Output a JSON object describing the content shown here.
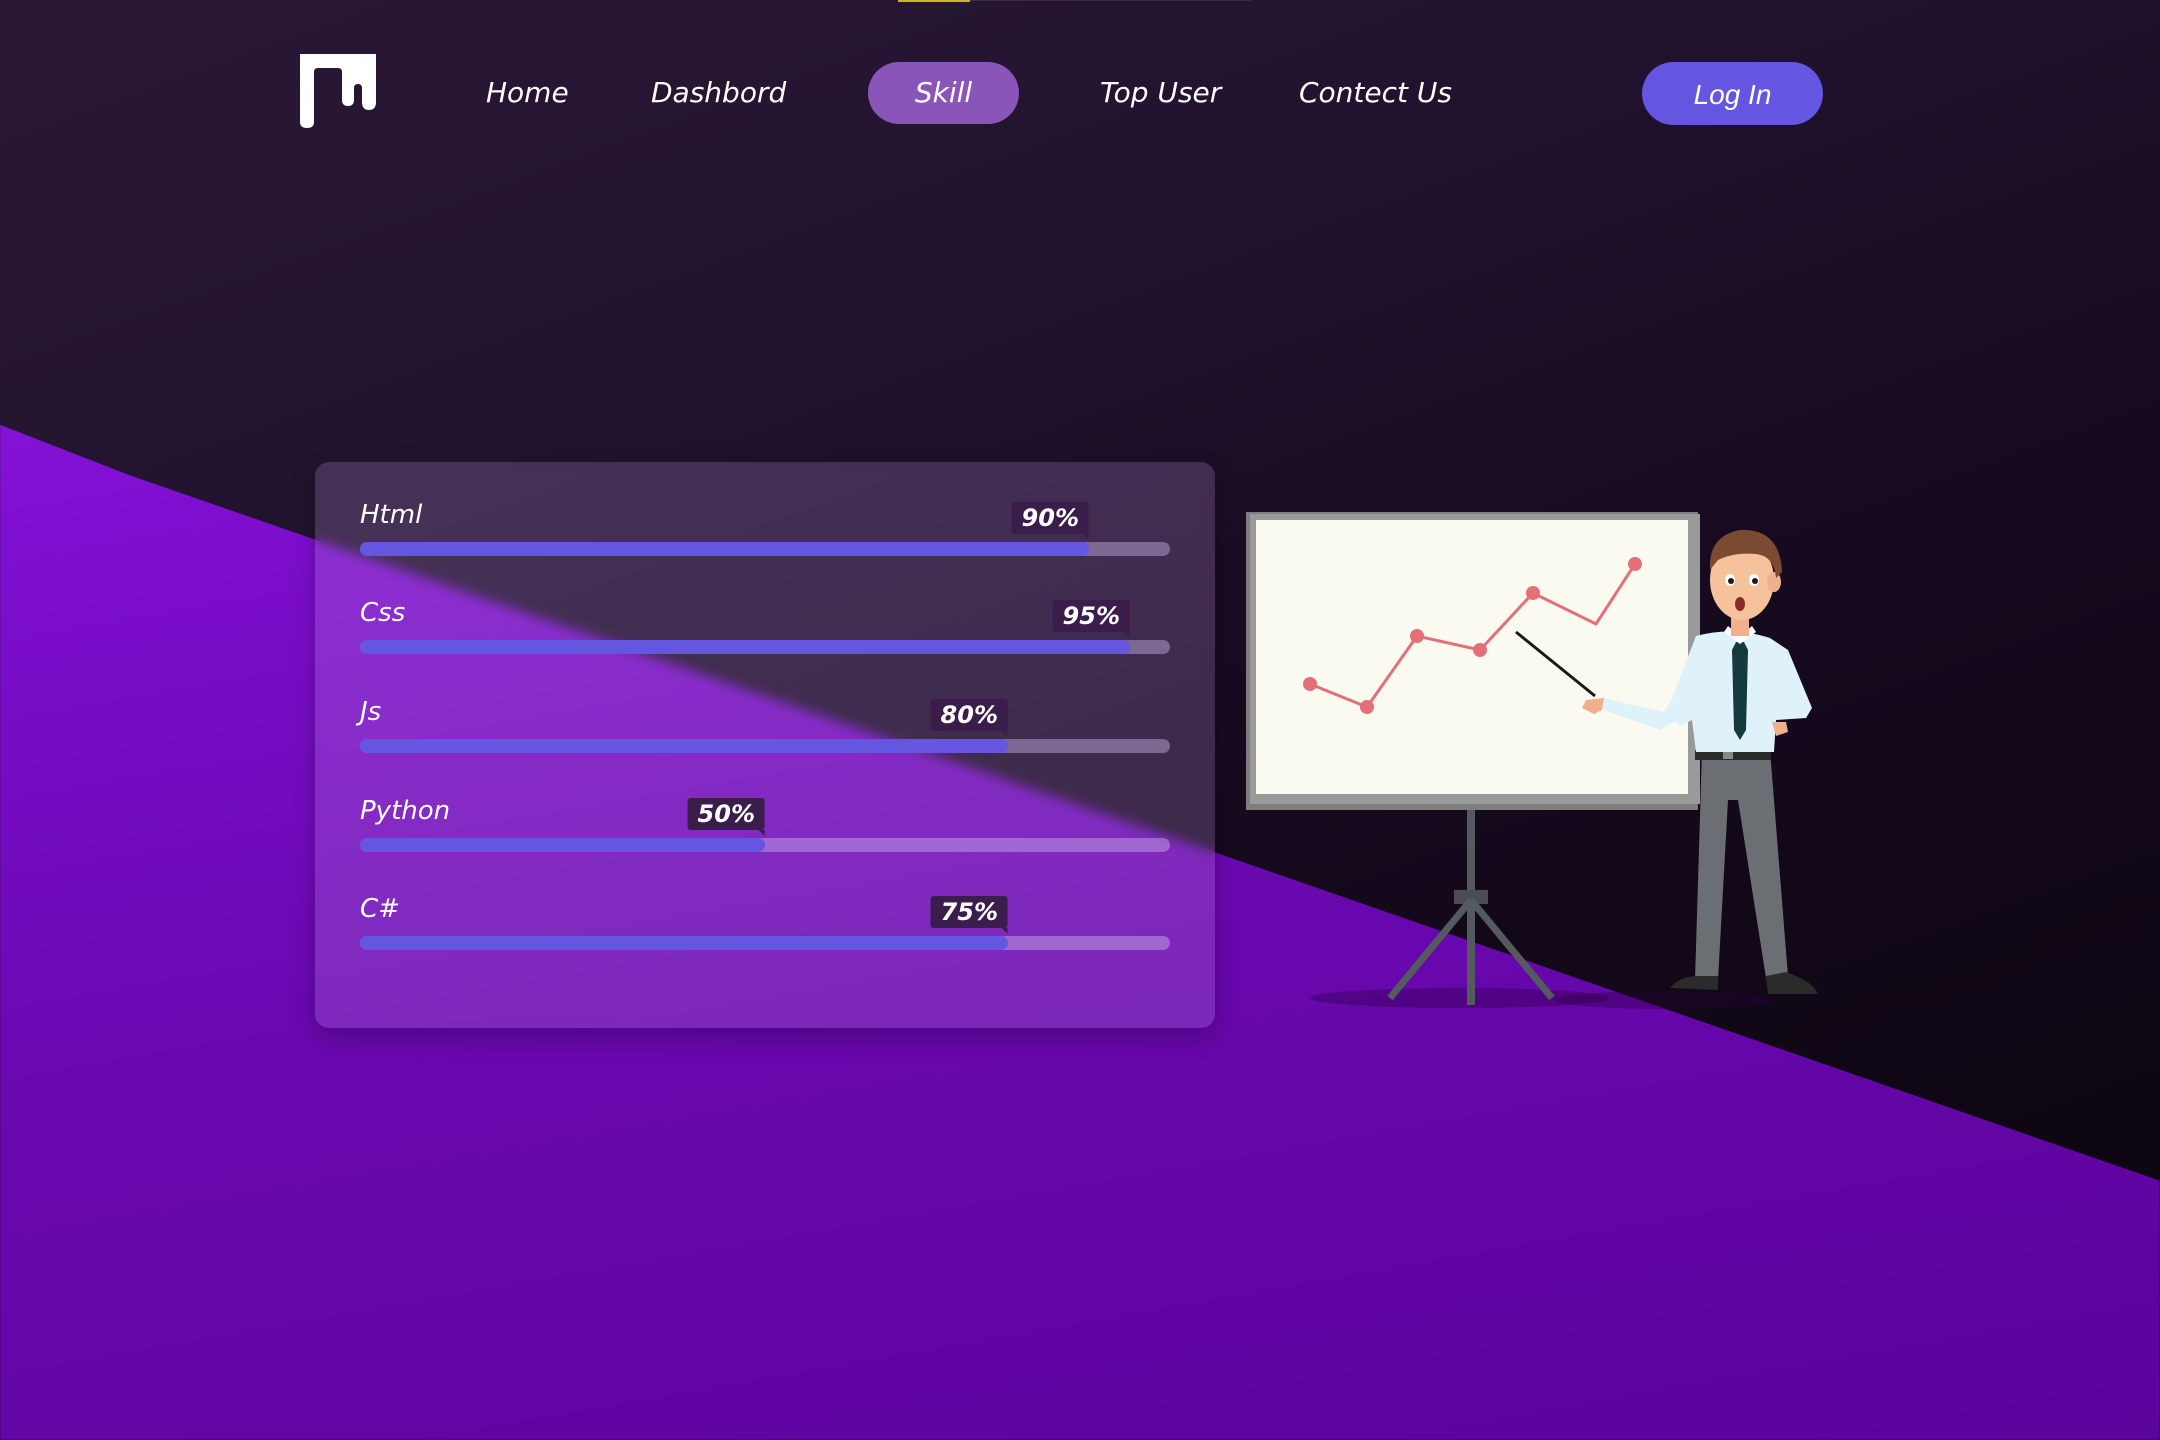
{
  "colors": {
    "accent": "#6456e0",
    "active_tab": "#8a55b8",
    "badge": "#3a1d4a",
    "chart_line": "#e8707a"
  },
  "logo": {
    "icon": "logo-icon"
  },
  "nav": {
    "items": [
      {
        "label": "Home",
        "active": false
      },
      {
        "label": "Dashbord",
        "active": false
      },
      {
        "label": "Skill",
        "active": true
      },
      {
        "label": "Top User",
        "active": false
      },
      {
        "label": "Contect Us",
        "active": false
      }
    ],
    "login_label": "Log In"
  },
  "skills": [
    {
      "name": "Html",
      "percent_label": "90%",
      "fill": 0.9
    },
    {
      "name": "Css",
      "percent_label": "95%",
      "fill": 0.95
    },
    {
      "name": "Js",
      "percent_label": "80%",
      "fill": 0.8
    },
    {
      "name": "Python",
      "percent_label": "50%",
      "fill": 0.5
    },
    {
      "name": "C#",
      "percent_label": "75%",
      "fill": 0.8
    }
  ],
  "illustration": {
    "icon": "presenter-whiteboard-illustration"
  }
}
